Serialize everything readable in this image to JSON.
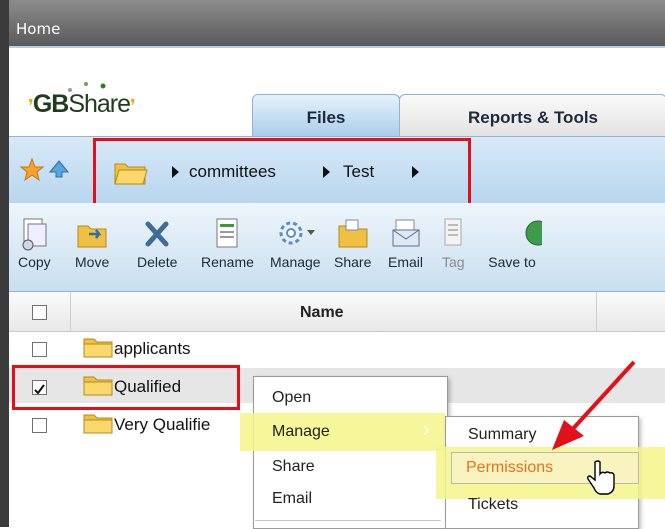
{
  "window": {
    "title": "Home"
  },
  "logo": {
    "text_bold": "GB",
    "text_rest": "Share"
  },
  "tabs": [
    {
      "label": "Files",
      "active": true
    },
    {
      "label": "Reports & Tools",
      "active": false
    }
  ],
  "breadcrumb": {
    "items": [
      "committees",
      "Test"
    ]
  },
  "toolbar": {
    "buttons": [
      {
        "label": "Copy",
        "icon": "copy-icon"
      },
      {
        "label": "Move",
        "icon": "move-icon"
      },
      {
        "label": "Delete",
        "icon": "delete-icon"
      },
      {
        "label": "Rename",
        "icon": "rename-icon"
      },
      {
        "label": "Manage",
        "icon": "manage-icon"
      },
      {
        "label": "Share",
        "icon": "share-icon"
      },
      {
        "label": "Email",
        "icon": "email-icon"
      },
      {
        "label": "Tag",
        "icon": "tag-icon",
        "disabled": true
      },
      {
        "label": "Save to",
        "icon": "save-to-icon"
      }
    ]
  },
  "grid": {
    "header": {
      "name": "Name"
    },
    "rows": [
      {
        "name": "applicants",
        "checked": false
      },
      {
        "name": "Qualified",
        "checked": true
      },
      {
        "name": "Very Qualifie",
        "checked": false
      }
    ]
  },
  "context_menu": {
    "items": [
      "Open",
      "Manage",
      "Share",
      "Email"
    ],
    "submenu_arrow": "›",
    "submenu": [
      "Summary",
      "Permissions",
      "Tickets"
    ]
  },
  "colors": {
    "highlight": "#f4f58a",
    "annotation_red": "#e2101b",
    "accent_blue": "#b8d6ee",
    "permissions_text": "#e8731a"
  }
}
